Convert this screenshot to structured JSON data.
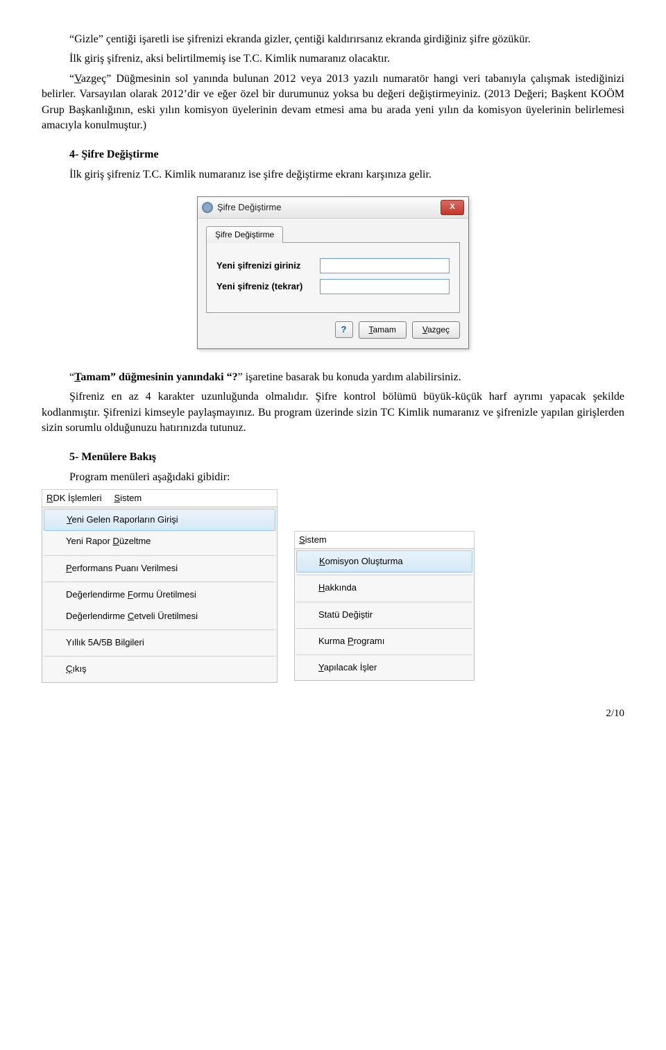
{
  "paragraphs": {
    "p1": "“Gizle” çentiği işaretli ise şifrenizi ekranda gizler, çentiği kaldırırsanız ekranda girdiğiniz şifre gözükür.",
    "p2": "İlk giriş şifreniz, aksi belirtilmemiş ise T.C. Kimlik numaranız olacaktır.",
    "p3_a": "“",
    "p3_v": "V",
    "p3_b": "azgeç” Düğmesinin sol yanında bulunan 2012 veya 2013 yazılı numaratör hangi veri tabanıyla çalışmak istediğinizi belirler. Varsayılan olarak 2012’dir ve eğer özel bir durumunuz yoksa bu değeri değiştirmeyiniz. (2013 Değeri; Başkent KOÖM Grup Başkanlığının, eski yılın komisyon üyelerinin devam etmesi ama bu arada yeni yılın da komisyon üyelerinin belirlemesi amacıyla konulmuştur.)",
    "sec4": "4- Şifre Değiştirme",
    "p4": "İlk giriş şifreniz T.C. Kimlik numaranız ise şifre değiştirme ekranı karşınıza gelir.",
    "p5_a": "“",
    "p5_t": "T",
    "p5_b": "amam” düğmesinin yanındaki “",
    "p5_q": "?",
    "p5_c": "” işaretine basarak bu konuda yardım alabilirsiniz.",
    "p6": "Şifreniz en az 4 karakter uzunluğunda olmalıdır. Şifre kontrol bölümü büyük-küçük harf ayrımı yapacak şekilde kodlanmıştır. Şifrenizi kimseyle paylaşmayınız. Bu program üzerinde sizin TC Kimlik numaranız ve şifrenizle yapılan girişlerden sizin sorumlu olduğunuzu hatırınızda tutunuz.",
    "sec5": "5- Menülere Bakış",
    "p7": "Program menüleri aşağıdaki gibidir:"
  },
  "dialog": {
    "title": "Şifre Değiştirme",
    "tab": "Şifre Değiştirme",
    "label1": "Yeni şifrenizi giriniz",
    "label2": "Yeni şifreniz (tekrar)",
    "help": "?",
    "ok_u": "T",
    "ok_rest": "amam",
    "cancel_u": "V",
    "cancel_rest": "azgeç",
    "close_x": "X"
  },
  "menus": {
    "bar1": {
      "m1_u": "R",
      "m1_r": "DK İşlemleri",
      "m2_u": "S",
      "m2_r": "istem"
    },
    "rdk": {
      "i1_a": "",
      "i1_u": "Y",
      "i1_b": "eni Gelen Raporların Girişi",
      "i2_a": "Yeni Rapor ",
      "i2_u": "D",
      "i2_b": "üzeltme",
      "i3_a": "",
      "i3_u": "P",
      "i3_b": "erformans Puanı Verilmesi",
      "i4_a": "Değerlendirme ",
      "i4_u": "F",
      "i4_b": "ormu Üretilmesi",
      "i5_a": "Değerlendirme ",
      "i5_u": "C",
      "i5_b": "etveli Üretilmesi",
      "i6_a": "",
      "i6_u": "",
      "i6_b": "Yıllık 5A/5B Bilgileri",
      "i7_a": "",
      "i7_u": "Ç",
      "i7_b": "ıkış"
    },
    "bar2": {
      "m1_u": "S",
      "m1_r": "istem"
    },
    "sistem": {
      "i1_a": "",
      "i1_u": "K",
      "i1_b": "omisyon Oluşturma",
      "i2_a": "",
      "i2_u": "H",
      "i2_b": "akkında",
      "i3_a": "",
      "i3_u": "",
      "i3_b": "Statü Değiştir",
      "i4_a": "Kurma ",
      "i4_u": "P",
      "i4_b": "rogramı",
      "i5_a": "",
      "i5_u": "Y",
      "i5_b": "apılacak İşler"
    }
  },
  "page": "2/10"
}
